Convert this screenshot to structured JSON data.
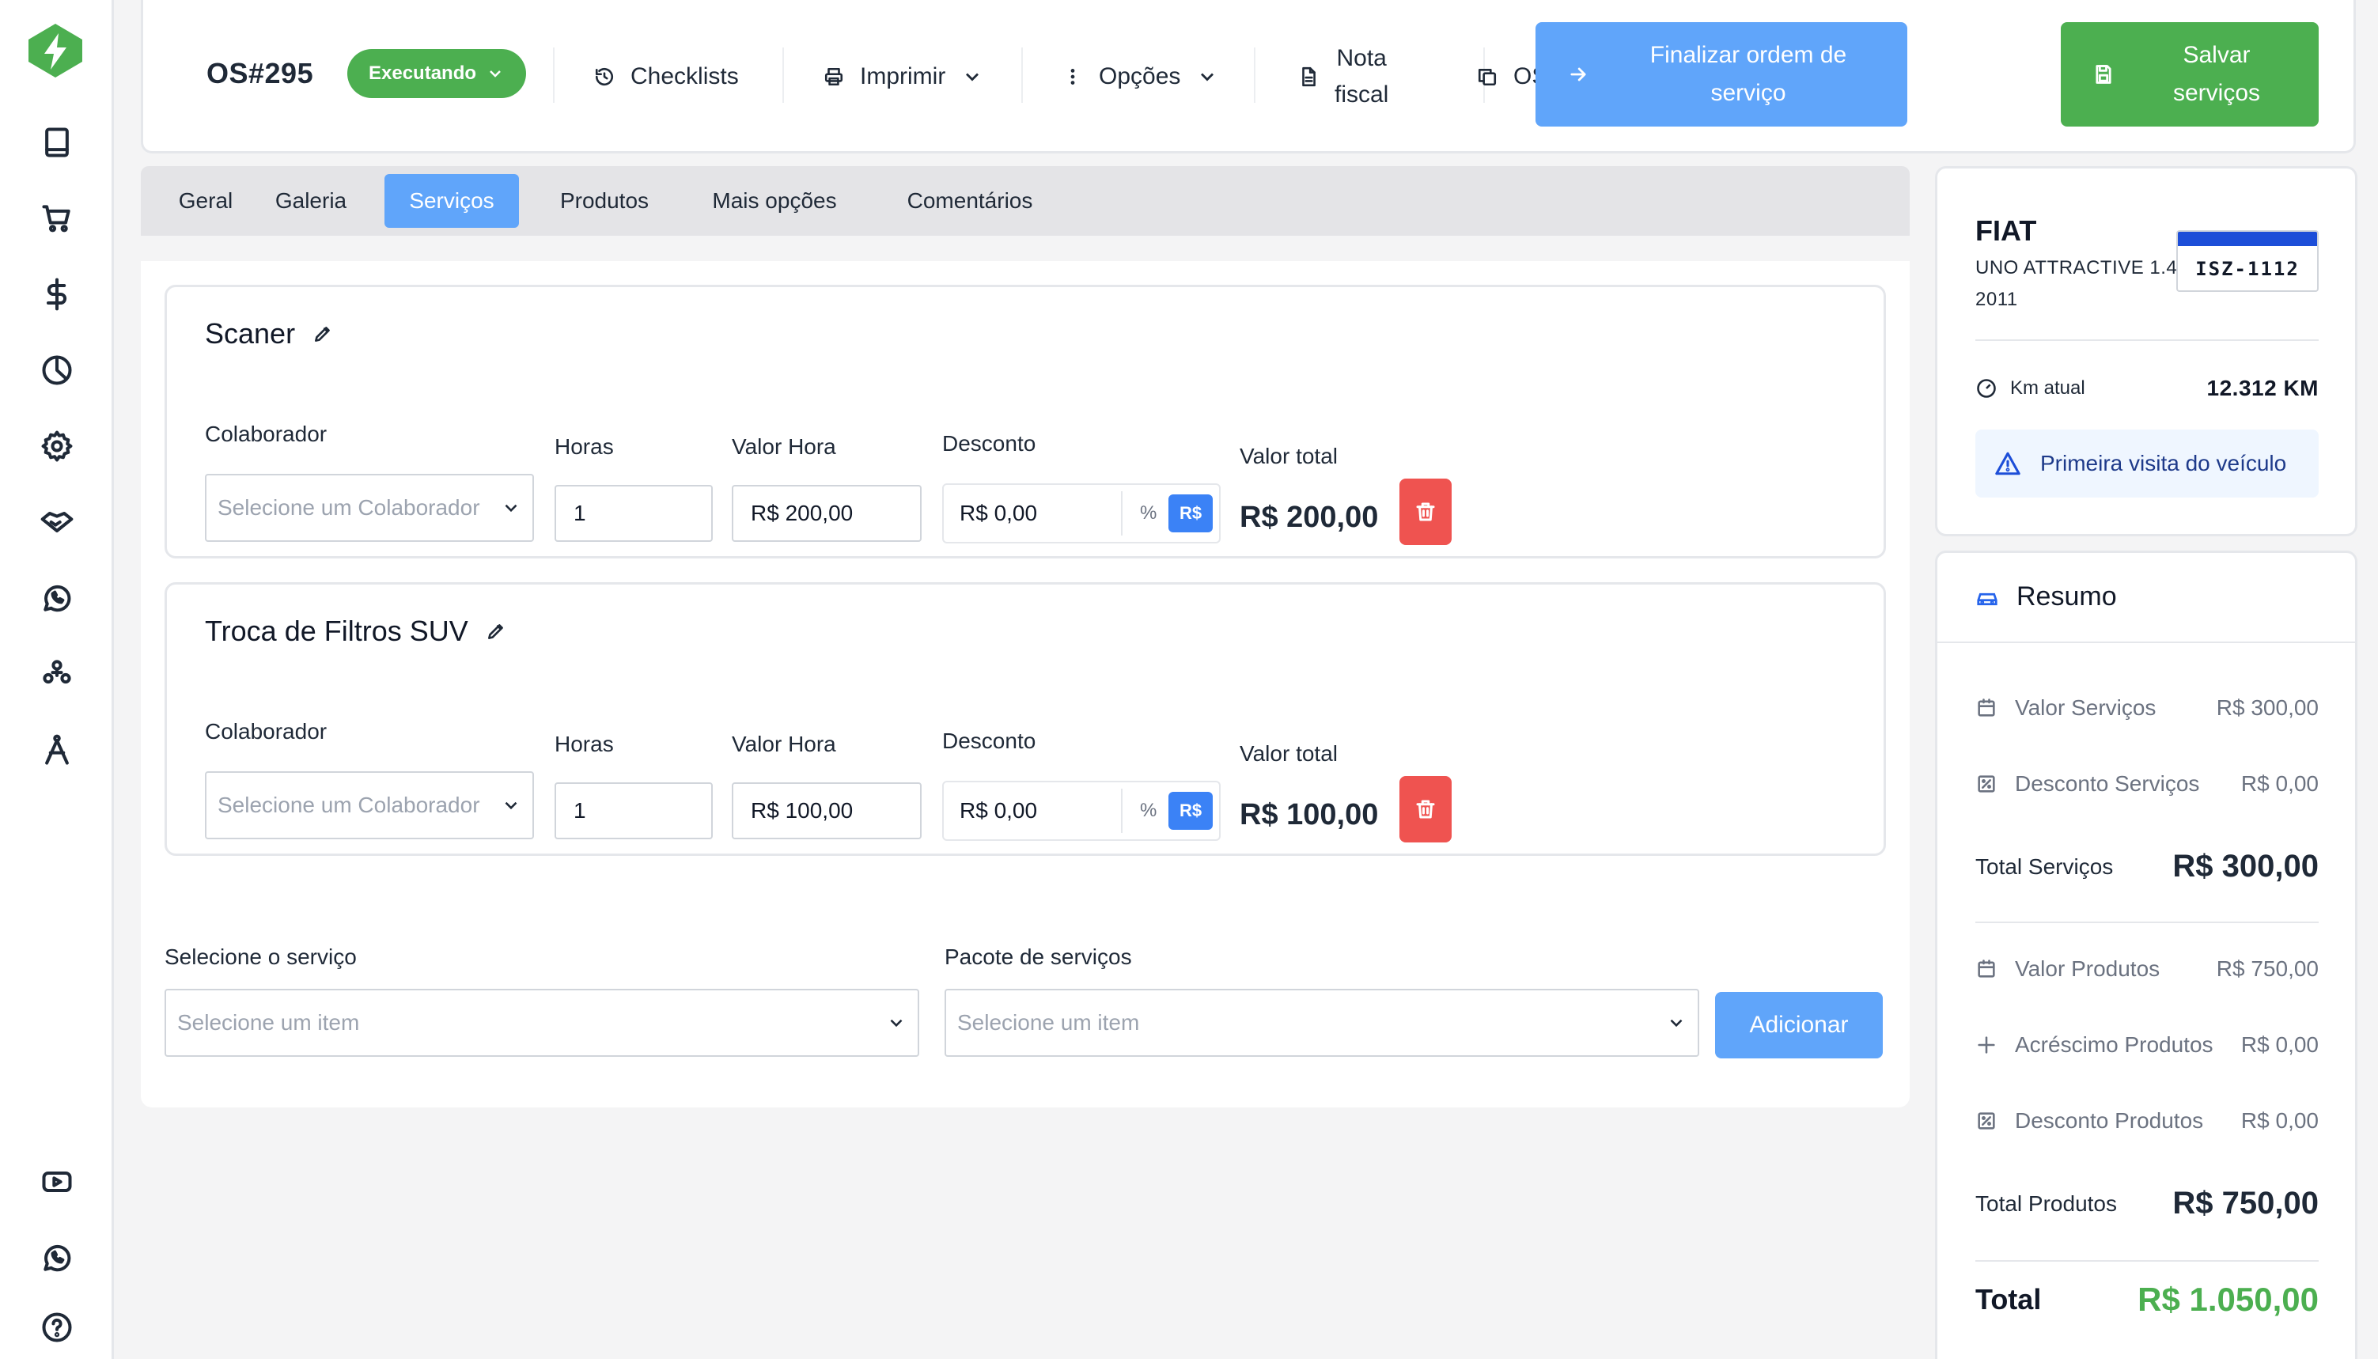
{
  "order": {
    "title": "OS#295",
    "status": "Executando"
  },
  "toolbar": {
    "checklists": "Checklists",
    "imprimir": "Imprimir",
    "opcoes": "Opções",
    "nota_line1": "Nota",
    "nota_line2": "fiscal",
    "os_digital": "OS Digital",
    "finalizar_line1": "Finalizar ordem de",
    "finalizar_line2": "serviço",
    "salvar_line1": "Salvar",
    "salvar_line2": "serviços"
  },
  "tabs": [
    {
      "label": "Geral"
    },
    {
      "label": "Galeria"
    },
    {
      "label": "Serviços",
      "active": true
    },
    {
      "label": "Produtos"
    },
    {
      "label": "Mais opções"
    },
    {
      "label": "Comentários"
    }
  ],
  "labels": {
    "colaborador": "Colaborador",
    "horas": "Horas",
    "valor_hora": "Valor Hora",
    "desconto": "Desconto",
    "valor_total": "Valor total",
    "colaborador_placeholder": "Selecione um Colaborador",
    "pct": "%",
    "rs": "R$"
  },
  "services": [
    {
      "name": "Scaner",
      "horas": "1",
      "valor_hora": "R$ 200,00",
      "desconto": "R$ 0,00",
      "total": "R$ 200,00"
    },
    {
      "name": "Troca de Filtros SUV",
      "horas": "1",
      "valor_hora": "R$ 100,00",
      "desconto": "R$ 0,00",
      "total": "R$ 100,00"
    }
  ],
  "add_service": {
    "service_label": "Selecione o serviço",
    "service_placeholder": "Selecione um item",
    "package_label": "Pacote de serviços",
    "package_placeholder": "Selecione um item",
    "add_button": "Adicionar"
  },
  "vehicle": {
    "brand": "FIAT",
    "model": "UNO ATTRACTIVE 1.4",
    "year": "2011",
    "plate": "ISZ-1112",
    "km_label": "Km atual",
    "km_value": "12.312 KM",
    "alert": "Primeira visita do veículo"
  },
  "summary": {
    "title": "Resumo",
    "valor_servicos_label": "Valor Serviços",
    "valor_servicos": "R$ 300,00",
    "desconto_servicos_label": "Desconto Serviços",
    "desconto_servicos": "R$ 0,00",
    "total_servicos_label": "Total Serviços",
    "total_servicos": "R$ 300,00",
    "valor_produtos_label": "Valor Produtos",
    "valor_produtos": "R$ 750,00",
    "acrescimo_produtos_label": "Acréscimo Produtos",
    "acrescimo_produtos": "R$ 0,00",
    "desconto_produtos_label": "Desconto Produtos",
    "desconto_produtos": "R$ 0,00",
    "total_produtos_label": "Total Produtos",
    "total_produtos": "R$ 750,00",
    "total_label": "Total",
    "total": "R$ 1.050,00"
  },
  "colors": {
    "accent_blue": "#60a5fa",
    "success_green": "#4caf50",
    "danger_red": "#ef5350",
    "plate_blue": "#1d4ed8"
  },
  "icons": {
    "sidebar": [
      "book-icon",
      "cart-icon",
      "dollar-icon",
      "pie-chart-icon",
      "gear-icon",
      "handshake-icon",
      "whatsapp-icon",
      "users-icon",
      "compass-icon",
      "youtube-icon",
      "whatsapp-icon",
      "help-icon"
    ]
  }
}
